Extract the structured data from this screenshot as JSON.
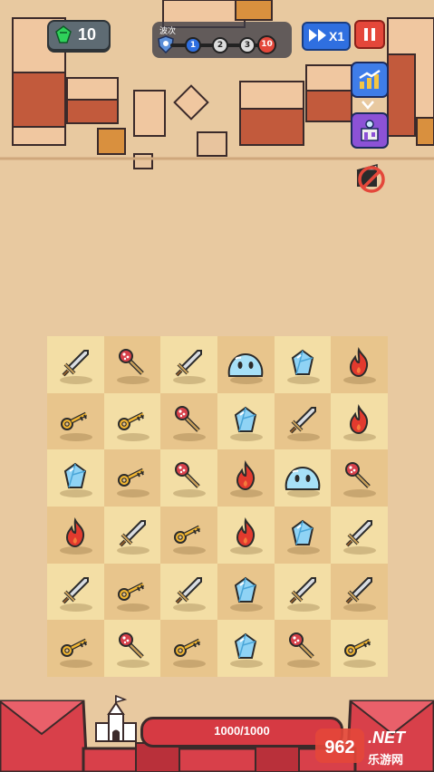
{
  "hud": {
    "gem_count": "10",
    "wave_label": "波次",
    "wave_steps": [
      "1",
      "2",
      "3",
      "10"
    ],
    "speed_label": "X1"
  },
  "side_buttons": [
    "chart-upgrade-icon",
    "shop-icon",
    "no-ads-icon"
  ],
  "board": {
    "rows": 6,
    "cols": 6,
    "grid": [
      [
        "sword",
        "mace",
        "sword",
        "slime",
        "crystal",
        "fire"
      ],
      [
        "key",
        "key",
        "mace",
        "crystal",
        "sword",
        "fire"
      ],
      [
        "crystal",
        "key",
        "mace",
        "fire",
        "slime",
        "mace"
      ],
      [
        "fire",
        "sword",
        "key",
        "fire",
        "crystal",
        "sword"
      ],
      [
        "sword",
        "key",
        "sword",
        "crystal",
        "sword",
        "sword"
      ],
      [
        "key",
        "mace",
        "key",
        "crystal",
        "mace",
        "key"
      ]
    ]
  },
  "castle": {
    "hp_text": "1000/1000"
  },
  "watermark": {
    "logo": "962",
    "top": ".NET",
    "bottom": "乐游网"
  },
  "colors": {
    "background": "#e8c9a0",
    "cell_light": "#f3dea5",
    "cell_dark": "#e8c58c",
    "hp_red": "#d63a43"
  }
}
